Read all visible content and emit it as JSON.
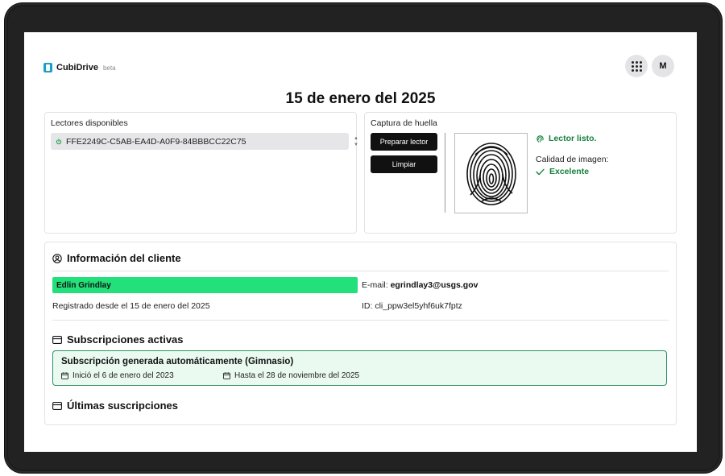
{
  "header": {
    "brand_name": "CubiDrive",
    "brand_badge": "beta",
    "avatar_initial": "M",
    "page_title": "15 de enero del 2025"
  },
  "readers": {
    "label": "Lectores disponibles",
    "selected_reader": "FFE2249C-C5AB-EA4D-A0F9-84BBBCC22C75"
  },
  "capture": {
    "label": "Captura de huella",
    "prepare_button": "Preparar lector",
    "clear_button": "Limpiar",
    "status": "Lector listo.",
    "quality_label": "Calidad de imagen:",
    "quality_value": "Excelente"
  },
  "client": {
    "section_title": "Información del cliente",
    "name": "Edlin Grindlay",
    "email_label": "E-mail:",
    "email": "egrindlay3@usgs.gov",
    "registered": "Registrado desde el 15 de enero del 2025",
    "id": "ID: cli_ppw3el5yhf6uk7fptz"
  },
  "subscriptions": {
    "section_title": "Subscripciones activas",
    "items": [
      {
        "title": "Subscripción generada automáticamente (Gimnasio)",
        "start": "Inició el 6 de enero del 2023",
        "end": "Hasta el 28 de noviembre del 2025"
      }
    ]
  },
  "recent": {
    "section_title": "Últimas suscripciones"
  },
  "colors": {
    "accent_green": "#22e07a",
    "status_green": "#15803d",
    "subscription_bg": "#eafaf1",
    "subscription_border": "#2f8f63",
    "brand_blue": "#1aa0c4"
  },
  "icons": {
    "apps": "grid-icon",
    "reader": "power-icon",
    "status": "fingerprint-icon",
    "quality": "check-icon",
    "client": "user-circle-icon",
    "subscriptions": "credit-card-icon",
    "calendar": "calendar-icon"
  }
}
